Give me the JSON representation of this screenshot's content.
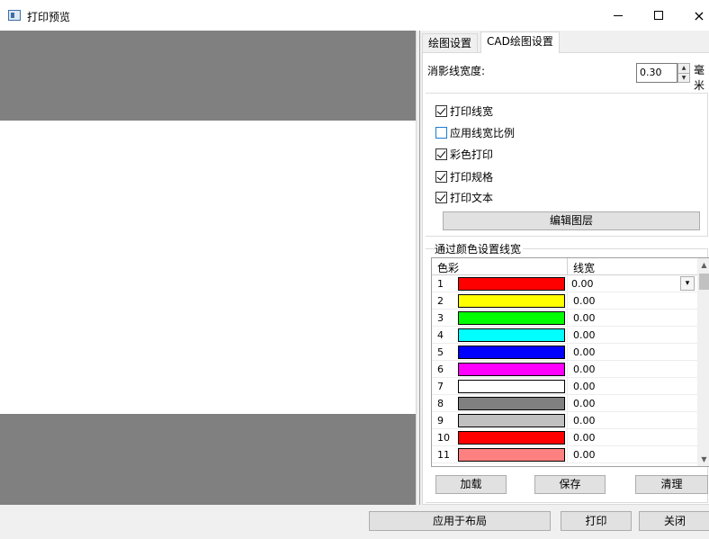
{
  "window": {
    "title": "打印预览",
    "minimize": "minimize",
    "maximize": "maximize",
    "close": "×"
  },
  "tabs": [
    {
      "label": "绘图设置",
      "active": false
    },
    {
      "label": "CAD绘图设置",
      "active": true
    }
  ],
  "hidden_line_width": {
    "label": "消影线宽度:",
    "value": "0.30",
    "unit": "毫米"
  },
  "checkboxes": [
    {
      "label": "打印线宽",
      "checked": true
    },
    {
      "label": "应用线宽比例",
      "checked": false
    },
    {
      "label": "彩色打印",
      "checked": true
    },
    {
      "label": "打印规格",
      "checked": true
    },
    {
      "label": "打印文本",
      "checked": true
    }
  ],
  "edit_layer_button": "编辑图层",
  "color_group": {
    "title": "通过颜色设置线宽",
    "col_color": "色彩",
    "col_width": "线宽",
    "rows": [
      {
        "num": "1",
        "color": "#ff0000",
        "width": "0.00"
      },
      {
        "num": "2",
        "color": "#ffff00",
        "width": "0.00"
      },
      {
        "num": "3",
        "color": "#00ff00",
        "width": "0.00"
      },
      {
        "num": "4",
        "color": "#00ffff",
        "width": "0.00"
      },
      {
        "num": "5",
        "color": "#0000ff",
        "width": "0.00"
      },
      {
        "num": "6",
        "color": "#ff00ff",
        "width": "0.00"
      },
      {
        "num": "7",
        "color": "#ffffff",
        "width": "0.00"
      },
      {
        "num": "8",
        "color": "#808080",
        "width": "0.00"
      },
      {
        "num": "9",
        "color": "#c0c0c0",
        "width": "0.00"
      },
      {
        "num": "10",
        "color": "#ff0000",
        "width": "0.00"
      },
      {
        "num": "11",
        "color": "#ff8080",
        "width": "0.00"
      }
    ]
  },
  "group_buttons": {
    "load": "加载",
    "save": "保存",
    "clear": "清理"
  },
  "footer": {
    "apply": "应用于布局",
    "print": "打印",
    "close": "关闭"
  }
}
